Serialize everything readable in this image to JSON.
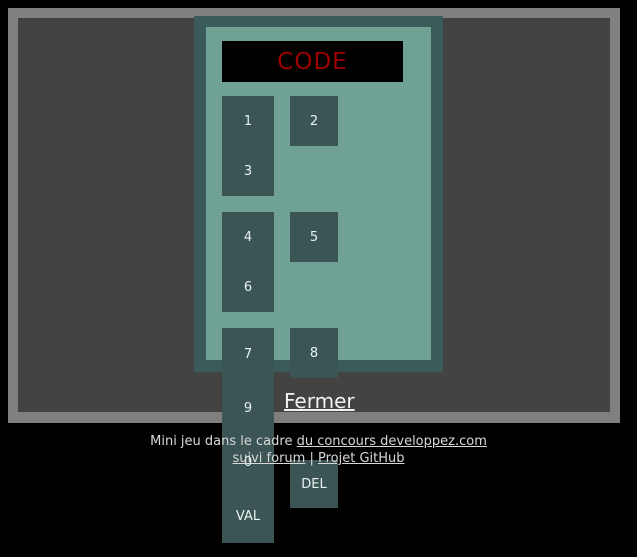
{
  "window": {
    "frame_color": "#808080",
    "body_color": "#434343"
  },
  "keypad": {
    "panel_border_color": "#3b5a5a",
    "panel_color": "#6fa294",
    "key_color": "#3b5555",
    "key_text_color": "#e8f2f2",
    "display": {
      "text": "CODE",
      "text_color": "#9c0000",
      "background_color": "#000000"
    },
    "keys": {
      "col_left_top": [
        "1",
        "3"
      ],
      "col_left_mid": [
        "4",
        "6"
      ],
      "col_left_bottom": [
        "7",
        "9",
        "0",
        "VAL"
      ],
      "key_2": "2",
      "key_5": "5",
      "key_8": "8",
      "key_del": "DEL"
    }
  },
  "close": {
    "label": "Fermer"
  },
  "footer": {
    "line1_prefix": "Mini jeu dans le cadre ",
    "line1_link": "du concours developpez.com",
    "line2_link1": "suivi forum",
    "line2_separator": " | ",
    "line2_link2": "Projet GitHub"
  }
}
